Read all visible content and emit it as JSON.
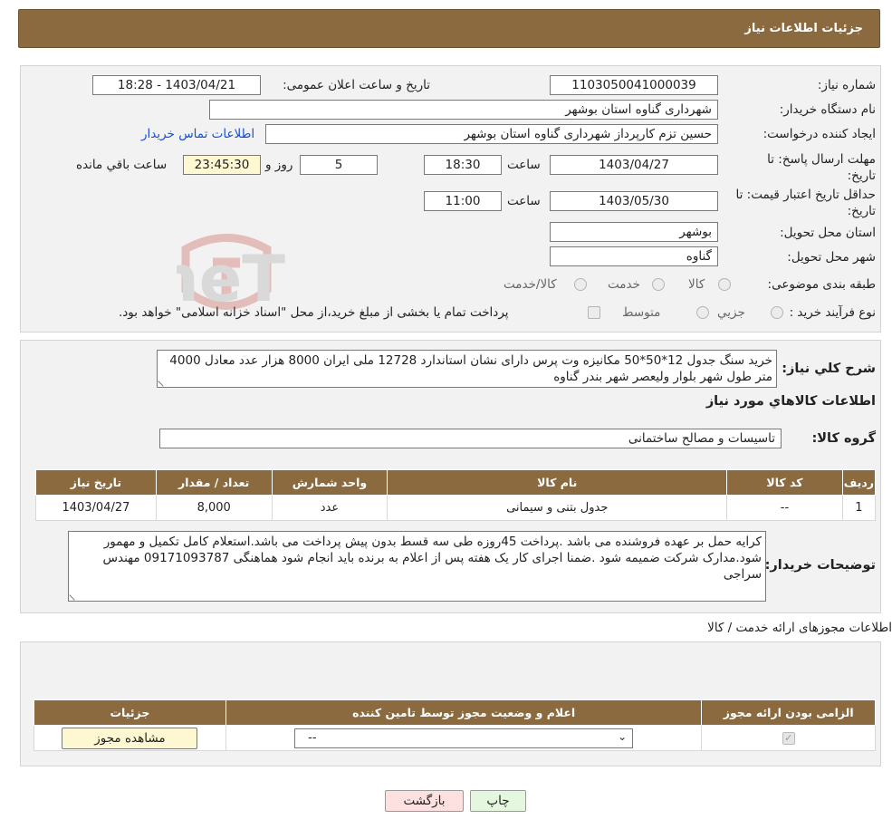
{
  "header": {
    "title": "جزئیات اطلاعات نیاز"
  },
  "labels": {
    "need_number": "شماره نیاز:",
    "announce_datetime": "تاریخ و ساعت اعلان عمومی:",
    "buyer_org": "نام دستگاه خریدار:",
    "requester": "ایجاد کننده درخواست:",
    "deadline": "مهلت ارسال پاسخ: تا تاریخ:",
    "hour": "ساعت",
    "day_and": "روز و",
    "remaining": "ساعت باقي مانده",
    "price_validity": "حداقل تاریخ اعتبار قیمت: تا تاریخ:",
    "province": "استان محل تحویل:",
    "city": "شهر محل تحویل:",
    "category": "طبقه بندی موضوعی:",
    "process_type": "نوع فرآیند خرید :"
  },
  "fields": {
    "need_number": "1103050041000039",
    "announce_datetime": "1403/04/21 - 18:28",
    "buyer_org": "شهرداری گناوه استان بوشهر",
    "requester": "حسین تزم کارپرداز شهرداری گناوه استان بوشهر",
    "buyer_contact_link": "اطلاعات تماس خریدار",
    "deadline_date": "1403/04/27",
    "deadline_time": "18:30",
    "days": "5",
    "remaining_time": "23:45:30",
    "validity_date": "1403/05/30",
    "validity_time": "11:00",
    "province": "بوشهر",
    "city": "گناوه"
  },
  "category_options": [
    "کالا",
    "خدمت",
    "کالا/خدمت"
  ],
  "process_options": [
    "جزيي",
    "متوسط"
  ],
  "process_note": "پرداخت تمام يا بخشی از مبلغ خريد،از محل \"اسناد خزانه اسلامی\" خواهد بود.",
  "general_desc": {
    "label": "شرح کلي نياز:",
    "text": "خرید سنگ جدول 12*50*50 مکانیزه وت پرس دارای نشان استاندارد 12728 ملی ایران 8000 هزار عدد معادل 4000 متر طول شهر بلوار ولیعصر شهر بندر گناوه"
  },
  "goods_info_title": "اطلاعات کالاهاي مورد نياز",
  "goods_group": {
    "label": "گروه کالا:",
    "value": "تاسیسات و مصالح ساختمانی"
  },
  "goods_table": {
    "headers": [
      "رديف",
      "کد کالا",
      "نام کالا",
      "واحد شمارش",
      "تعداد / مقدار",
      "تاریخ نیاز"
    ],
    "rows": [
      [
        "1",
        "--",
        "جدول بتنی و سیمانی",
        "عدد",
        "8,000",
        "1403/04/27"
      ]
    ]
  },
  "buyer_notes": {
    "label": "توضیحات خریدار:",
    "text": "کرایه حمل بر عهده فروشنده می باشد .پرداخت 45روزه طی سه قسط بدون پیش پرداخت می باشد.استعلام کامل تکمیل و مهمور شود.مدارک شرکت ضمیمه شود .ضمنا اجرای کار یک هفته پس از اعلام به برنده باید انجام شود هماهنگی 09171093787 مهندس سراجی"
  },
  "permits_title": "اطلاعات مجوزهای ارائه خدمت / کالا",
  "permits_table": {
    "headers": [
      "الزامی بودن ارائه مجوز",
      "اعلام و وضعیت مجوز توسط تامین کننده",
      "جزئیات"
    ],
    "select_value": "--",
    "view_button": "مشاهده مجوز"
  },
  "buttons": {
    "print": "چاپ",
    "back": "بازگشت"
  },
  "watermark_text": "AriaTender.neT",
  "colors": {
    "header_bg": "#8a6a3e",
    "panel_bg": "#f2f2f2",
    "link": "#1a4fd0",
    "yellow_box": "#fdf7d2",
    "back_btn": "#fde0e0",
    "print_btn": "#e6f7df"
  }
}
